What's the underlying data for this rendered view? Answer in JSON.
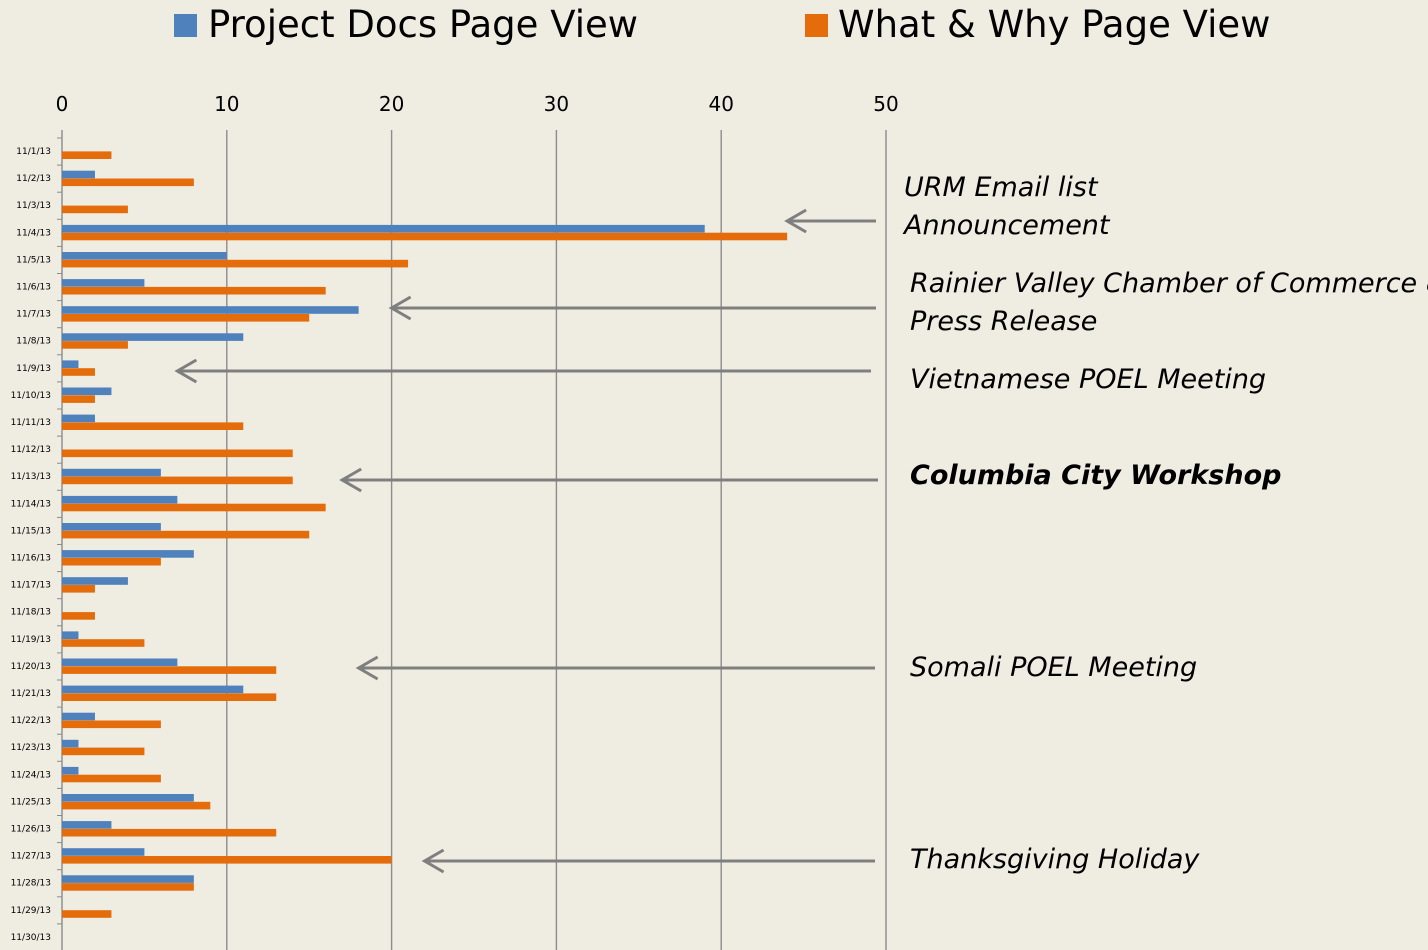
{
  "chart_data": {
    "type": "bar",
    "orientation": "horizontal",
    "categories": [
      "11/1/13",
      "11/2/13",
      "11/3/13",
      "11/4/13",
      "11/5/13",
      "11/6/13",
      "11/7/13",
      "11/8/13",
      "11/9/13",
      "11/10/13",
      "11/11/13",
      "11/12/13",
      "11/13/13",
      "11/14/13",
      "11/15/13",
      "11/16/13",
      "11/17/13",
      "11/18/13",
      "11/19/13",
      "11/20/13",
      "11/21/13",
      "11/22/13",
      "11/23/13",
      "11/24/13",
      "11/25/13",
      "11/26/13",
      "11/27/13",
      "11/28/13",
      "11/29/13",
      "11/30/13"
    ],
    "series": [
      {
        "name": "Project Docs Page View",
        "color": "#4f81bd",
        "values": [
          0,
          2,
          0,
          39,
          10,
          5,
          18,
          11,
          1,
          3,
          2,
          0,
          6,
          7,
          6,
          8,
          4,
          0,
          1,
          7,
          11,
          2,
          1,
          1,
          8,
          3,
          5,
          8,
          0,
          0
        ]
      },
      {
        "name": "What & Why Page View",
        "color": "#e46c0a",
        "values": [
          3,
          8,
          4,
          44,
          21,
          16,
          15,
          4,
          2,
          2,
          11,
          14,
          14,
          16,
          15,
          6,
          2,
          2,
          5,
          13,
          13,
          6,
          5,
          6,
          9,
          13,
          20,
          8,
          3,
          0
        ]
      }
    ],
    "xlim": [
      0,
      50
    ],
    "x_ticks": [
      0,
      10,
      20,
      30,
      40,
      50
    ],
    "grid": true,
    "legend_position": "top",
    "title": "",
    "xlabel": "",
    "ylabel": "",
    "annotations": [
      {
        "text": "URM Email list Announcement",
        "lines": [
          "URM Email list",
          "Announcement"
        ],
        "bold": false,
        "arrow_from": "11/4/13",
        "arrow_value": 44
      },
      {
        "text": "Rainier Valley Chamber of Commerce & Press Release",
        "lines": [
          "Rainier Valley Chamber of Commerce &",
          "Press Release"
        ],
        "bold": false,
        "arrow_from": "11/7/13",
        "arrow_value": 20
      },
      {
        "text": "Vietnamese POEL Meeting",
        "lines": [
          "Vietnamese POEL Meeting"
        ],
        "bold": false,
        "arrow_from": "11/9/13",
        "arrow_value": 7
      },
      {
        "text": "Columbia City Workshop",
        "lines": [
          "Columbia City Workshop"
        ],
        "bold": true,
        "arrow_from": "11/13/13",
        "arrow_value": 17
      },
      {
        "text": "Somali POEL Meeting",
        "lines": [
          "Somali POEL Meeting"
        ],
        "bold": false,
        "arrow_from": "11/20/13",
        "arrow_value": 18
      },
      {
        "text": "Thanksgiving Holiday",
        "lines": [
          "Thanksgiving Holiday"
        ],
        "bold": false,
        "arrow_from": "11/27/13",
        "arrow_value": 22
      }
    ]
  }
}
